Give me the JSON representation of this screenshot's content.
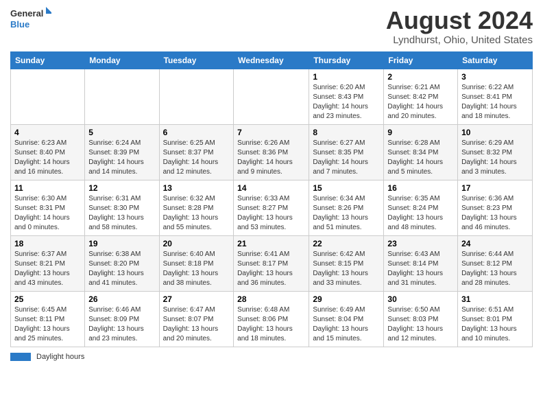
{
  "logo": {
    "line1": "General",
    "line2": "Blue"
  },
  "title": "August 2024",
  "subtitle": "Lyndhurst, Ohio, United States",
  "days_header": [
    "Sunday",
    "Monday",
    "Tuesday",
    "Wednesday",
    "Thursday",
    "Friday",
    "Saturday"
  ],
  "weeks": [
    [
      {
        "day": "",
        "info": ""
      },
      {
        "day": "",
        "info": ""
      },
      {
        "day": "",
        "info": ""
      },
      {
        "day": "",
        "info": ""
      },
      {
        "day": "1",
        "info": "Sunrise: 6:20 AM\nSunset: 8:43 PM\nDaylight: 14 hours\nand 23 minutes."
      },
      {
        "day": "2",
        "info": "Sunrise: 6:21 AM\nSunset: 8:42 PM\nDaylight: 14 hours\nand 20 minutes."
      },
      {
        "day": "3",
        "info": "Sunrise: 6:22 AM\nSunset: 8:41 PM\nDaylight: 14 hours\nand 18 minutes."
      }
    ],
    [
      {
        "day": "4",
        "info": "Sunrise: 6:23 AM\nSunset: 8:40 PM\nDaylight: 14 hours\nand 16 minutes."
      },
      {
        "day": "5",
        "info": "Sunrise: 6:24 AM\nSunset: 8:39 PM\nDaylight: 14 hours\nand 14 minutes."
      },
      {
        "day": "6",
        "info": "Sunrise: 6:25 AM\nSunset: 8:37 PM\nDaylight: 14 hours\nand 12 minutes."
      },
      {
        "day": "7",
        "info": "Sunrise: 6:26 AM\nSunset: 8:36 PM\nDaylight: 14 hours\nand 9 minutes."
      },
      {
        "day": "8",
        "info": "Sunrise: 6:27 AM\nSunset: 8:35 PM\nDaylight: 14 hours\nand 7 minutes."
      },
      {
        "day": "9",
        "info": "Sunrise: 6:28 AM\nSunset: 8:34 PM\nDaylight: 14 hours\nand 5 minutes."
      },
      {
        "day": "10",
        "info": "Sunrise: 6:29 AM\nSunset: 8:32 PM\nDaylight: 14 hours\nand 3 minutes."
      }
    ],
    [
      {
        "day": "11",
        "info": "Sunrise: 6:30 AM\nSunset: 8:31 PM\nDaylight: 14 hours\nand 0 minutes."
      },
      {
        "day": "12",
        "info": "Sunrise: 6:31 AM\nSunset: 8:30 PM\nDaylight: 13 hours\nand 58 minutes."
      },
      {
        "day": "13",
        "info": "Sunrise: 6:32 AM\nSunset: 8:28 PM\nDaylight: 13 hours\nand 55 minutes."
      },
      {
        "day": "14",
        "info": "Sunrise: 6:33 AM\nSunset: 8:27 PM\nDaylight: 13 hours\nand 53 minutes."
      },
      {
        "day": "15",
        "info": "Sunrise: 6:34 AM\nSunset: 8:26 PM\nDaylight: 13 hours\nand 51 minutes."
      },
      {
        "day": "16",
        "info": "Sunrise: 6:35 AM\nSunset: 8:24 PM\nDaylight: 13 hours\nand 48 minutes."
      },
      {
        "day": "17",
        "info": "Sunrise: 6:36 AM\nSunset: 8:23 PM\nDaylight: 13 hours\nand 46 minutes."
      }
    ],
    [
      {
        "day": "18",
        "info": "Sunrise: 6:37 AM\nSunset: 8:21 PM\nDaylight: 13 hours\nand 43 minutes."
      },
      {
        "day": "19",
        "info": "Sunrise: 6:38 AM\nSunset: 8:20 PM\nDaylight: 13 hours\nand 41 minutes."
      },
      {
        "day": "20",
        "info": "Sunrise: 6:40 AM\nSunset: 8:18 PM\nDaylight: 13 hours\nand 38 minutes."
      },
      {
        "day": "21",
        "info": "Sunrise: 6:41 AM\nSunset: 8:17 PM\nDaylight: 13 hours\nand 36 minutes."
      },
      {
        "day": "22",
        "info": "Sunrise: 6:42 AM\nSunset: 8:15 PM\nDaylight: 13 hours\nand 33 minutes."
      },
      {
        "day": "23",
        "info": "Sunrise: 6:43 AM\nSunset: 8:14 PM\nDaylight: 13 hours\nand 31 minutes."
      },
      {
        "day": "24",
        "info": "Sunrise: 6:44 AM\nSunset: 8:12 PM\nDaylight: 13 hours\nand 28 minutes."
      }
    ],
    [
      {
        "day": "25",
        "info": "Sunrise: 6:45 AM\nSunset: 8:11 PM\nDaylight: 13 hours\nand 25 minutes."
      },
      {
        "day": "26",
        "info": "Sunrise: 6:46 AM\nSunset: 8:09 PM\nDaylight: 13 hours\nand 23 minutes."
      },
      {
        "day": "27",
        "info": "Sunrise: 6:47 AM\nSunset: 8:07 PM\nDaylight: 13 hours\nand 20 minutes."
      },
      {
        "day": "28",
        "info": "Sunrise: 6:48 AM\nSunset: 8:06 PM\nDaylight: 13 hours\nand 18 minutes."
      },
      {
        "day": "29",
        "info": "Sunrise: 6:49 AM\nSunset: 8:04 PM\nDaylight: 13 hours\nand 15 minutes."
      },
      {
        "day": "30",
        "info": "Sunrise: 6:50 AM\nSunset: 8:03 PM\nDaylight: 13 hours\nand 12 minutes."
      },
      {
        "day": "31",
        "info": "Sunrise: 6:51 AM\nSunset: 8:01 PM\nDaylight: 13 hours\nand 10 minutes."
      }
    ]
  ],
  "footer": {
    "label": "Daylight hours"
  }
}
